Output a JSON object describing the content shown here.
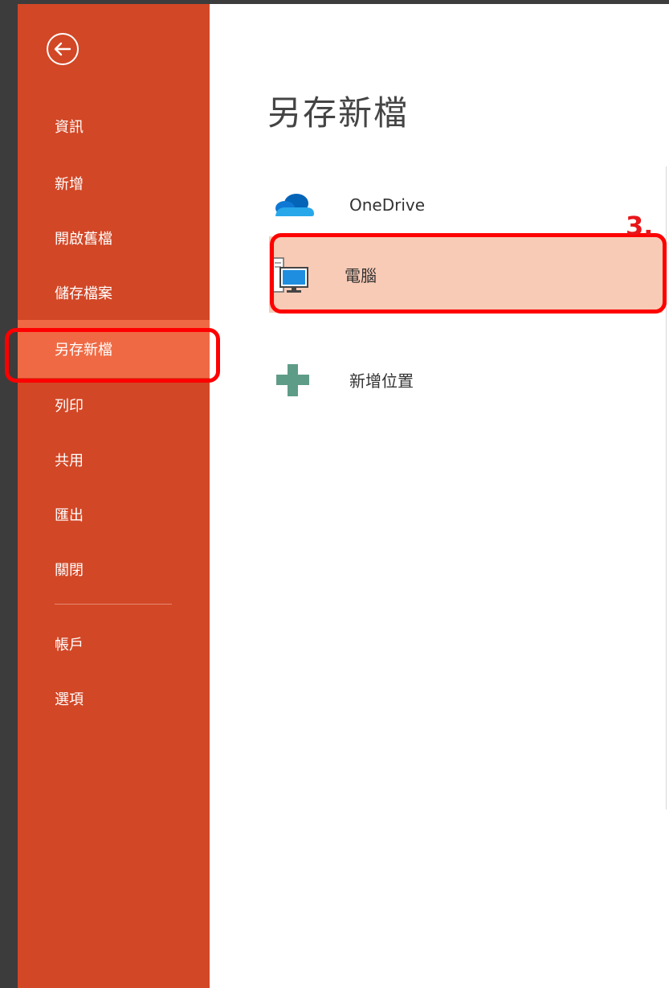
{
  "sidebar": {
    "back_icon": "back-arrow-icon",
    "items": [
      {
        "label": "資訊"
      },
      {
        "label": "新增"
      },
      {
        "label": "開啟舊檔"
      },
      {
        "label": "儲存檔案"
      },
      {
        "label": "另存新檔",
        "active": true
      },
      {
        "label": "列印"
      },
      {
        "label": "共用"
      },
      {
        "label": "匯出"
      },
      {
        "label": "關閉"
      }
    ],
    "bottom_items": [
      {
        "label": "帳戶"
      },
      {
        "label": "選項"
      }
    ],
    "background_color": "#d24726",
    "active_color": "#ef6a44"
  },
  "main": {
    "title": "另存新檔",
    "locations": [
      {
        "label": "OneDrive",
        "icon": "onedrive-cloud-icon"
      },
      {
        "label": "電腦",
        "icon": "computer-icon",
        "selected": true
      },
      {
        "label": "新增位置",
        "icon": "add-plus-icon"
      }
    ],
    "selected_color": "#f8cbb6"
  },
  "annotation": {
    "step": "3.",
    "color": "#ff0000"
  }
}
